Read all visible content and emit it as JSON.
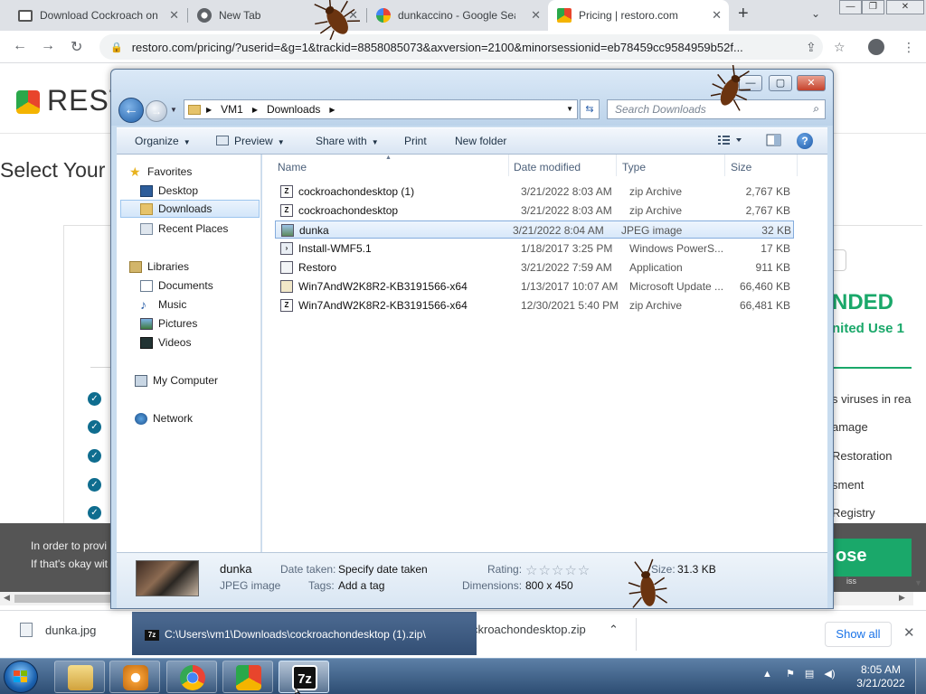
{
  "browser": {
    "tabs": [
      {
        "label": "Download Cockroach on",
        "icon": "monitor-icon"
      },
      {
        "label": "New Tab",
        "icon": "chrome-icon"
      },
      {
        "label": "dunkaccino - Google Sea",
        "icon": "google-icon"
      },
      {
        "label": "Pricing | restoro.com",
        "icon": "restoro-icon",
        "active": true
      }
    ],
    "url": "restoro.com/pricing/?userid=&g=1&trackid=8858085073&axversion=2100&minorsessionid=eb78459cc9584959b52f..."
  },
  "page": {
    "logo": "REST",
    "select_title": "Select Your",
    "recommended": "NDED",
    "unlimited": "nited Use 1",
    "features": [
      "s viruses in rea",
      "amage",
      "Restoration",
      "sment",
      "Registry"
    ],
    "cookie_line1": "In order to provi",
    "cookie_line2": "If that's okay wit",
    "close_label": "ose",
    "close_small": "iss"
  },
  "downloads": {
    "items": [
      {
        "label": "dunka.jpg"
      },
      {
        "label": "ckroachondesktop.zip"
      }
    ],
    "show_all": "Show all",
    "tooltip": "C:\\Users\\vm1\\Downloads\\cockroachondesktop (1).zip\\"
  },
  "explorer": {
    "address": {
      "crumbs": [
        "VM1",
        "Downloads"
      ]
    },
    "search_placeholder": "Search Downloads",
    "commands": {
      "organize": "Organize",
      "preview": "Preview",
      "share": "Share with",
      "print": "Print",
      "new_folder": "New folder"
    },
    "nav": {
      "favorites": "Favorites",
      "desktop": "Desktop",
      "downloads": "Downloads",
      "recent": "Recent Places",
      "libraries": "Libraries",
      "documents": "Documents",
      "music": "Music",
      "pictures": "Pictures",
      "videos": "Videos",
      "computer": "My Computer",
      "network": "Network"
    },
    "columns": {
      "name": "Name",
      "date": "Date modified",
      "type": "Type",
      "size": "Size"
    },
    "files": [
      {
        "name": "cockroachondesktop (1)",
        "date": "3/21/2022 8:03 AM",
        "type": "zip Archive",
        "size": "2,767 KB"
      },
      {
        "name": "cockroachondesktop",
        "date": "3/21/2022 8:03 AM",
        "type": "zip Archive",
        "size": "2,767 KB"
      },
      {
        "name": "dunka",
        "date": "3/21/2022 8:04 AM",
        "type": "JPEG image",
        "size": "32 KB"
      },
      {
        "name": "Install-WMF5.1",
        "date": "1/18/2017 3:25 PM",
        "type": "Windows PowerS...",
        "size": "17 KB"
      },
      {
        "name": "Restoro",
        "date": "3/21/2022 7:59 AM",
        "type": "Application",
        "size": "911 KB"
      },
      {
        "name": "Win7AndW2K8R2-KB3191566-x64",
        "date": "1/13/2017 10:07 AM",
        "type": "Microsoft Update ...",
        "size": "66,460 KB"
      },
      {
        "name": "Win7AndW2K8R2-KB3191566-x64",
        "date": "12/30/2021 5:40 PM",
        "type": "zip Archive",
        "size": "66,481 KB"
      }
    ],
    "details": {
      "name": "dunka",
      "type": "JPEG image",
      "date_label": "Date taken:",
      "date_value": "Specify date taken",
      "tags_label": "Tags:",
      "tags_value": "Add a tag",
      "rating_label": "Rating:",
      "dims_label": "Dimensions:",
      "dims_value": "800 x 450",
      "size_label": "Size:",
      "size_value": "31.3 KB"
    }
  },
  "taskbar": {
    "time": "8:05 AM",
    "date": "3/21/2022"
  }
}
